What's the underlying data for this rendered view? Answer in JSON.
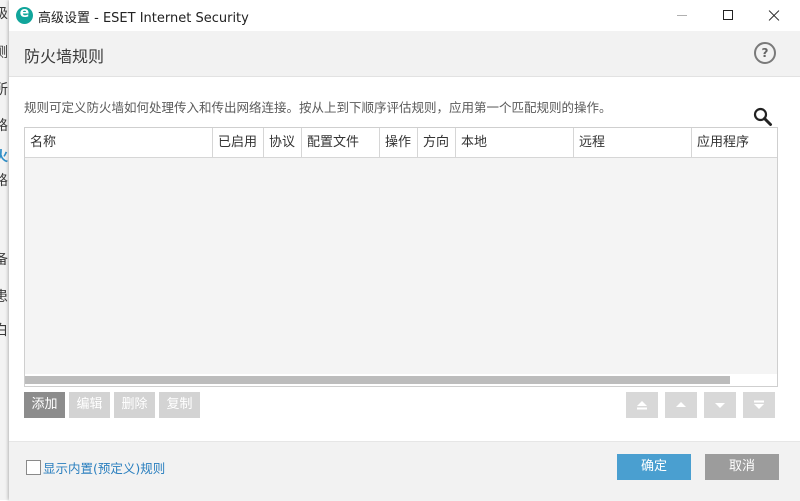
{
  "window": {
    "title": "高级设置 - ESET Internet Security"
  },
  "background_window": {
    "fragments": [
      "级",
      "测",
      "所",
      "路",
      "火",
      "路",
      "：",
      "备",
      "患",
      "白"
    ]
  },
  "header": {
    "title": "防火墙规则",
    "help_label": "?"
  },
  "description": "规则可定义防火墙如何处理传入和传出网络连接。按从上到下顺序评估规则，应用第一个匹配规则的操作。",
  "table": {
    "columns": [
      "名称",
      "已启用",
      "协议",
      "配置文件",
      "操作",
      "方向",
      "本地",
      "远程",
      "应用程序"
    ],
    "rows": []
  },
  "actions": {
    "add": "添加",
    "edit": "编辑",
    "delete": "删除",
    "copy": "复制"
  },
  "footer": {
    "show_builtin_label": "显示内置(预定义)规则",
    "show_builtin_checked": false,
    "ok": "确定",
    "cancel": "取消"
  },
  "colors": {
    "accent": "#4a9fd0",
    "brand": "#11a59b",
    "link": "#2a7fbf"
  }
}
